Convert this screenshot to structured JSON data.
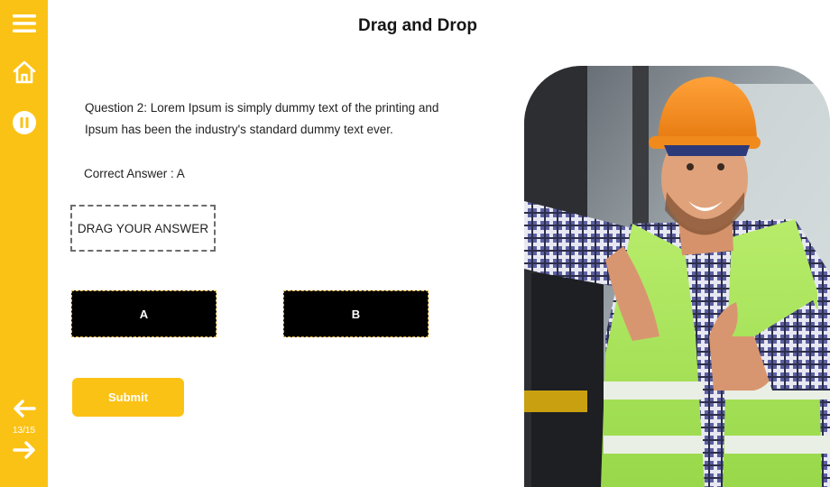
{
  "page": {
    "title": "Drag and Drop"
  },
  "sidebar": {
    "menu_icon": "hamburger-menu-icon",
    "home_icon": "home-icon",
    "pause_icon": "pause-icon",
    "prev_icon": "arrow-left-icon",
    "next_icon": "arrow-right-icon",
    "progress": "13/15",
    "accent_color": "#FBC216"
  },
  "question": {
    "text": "Question 2: Lorem Ipsum is simply dummy text of the printing and Ipsum has been the industry's standard dummy text ever.",
    "correct_answer": "Correct Answer : A",
    "drop_zone_label": "DRAG YOUR ANSWER"
  },
  "options": [
    {
      "label": "A"
    },
    {
      "label": "B"
    }
  ],
  "actions": {
    "submit_label": "Submit"
  },
  "image": {
    "subject": "worker-with-hard-hat-photo"
  }
}
